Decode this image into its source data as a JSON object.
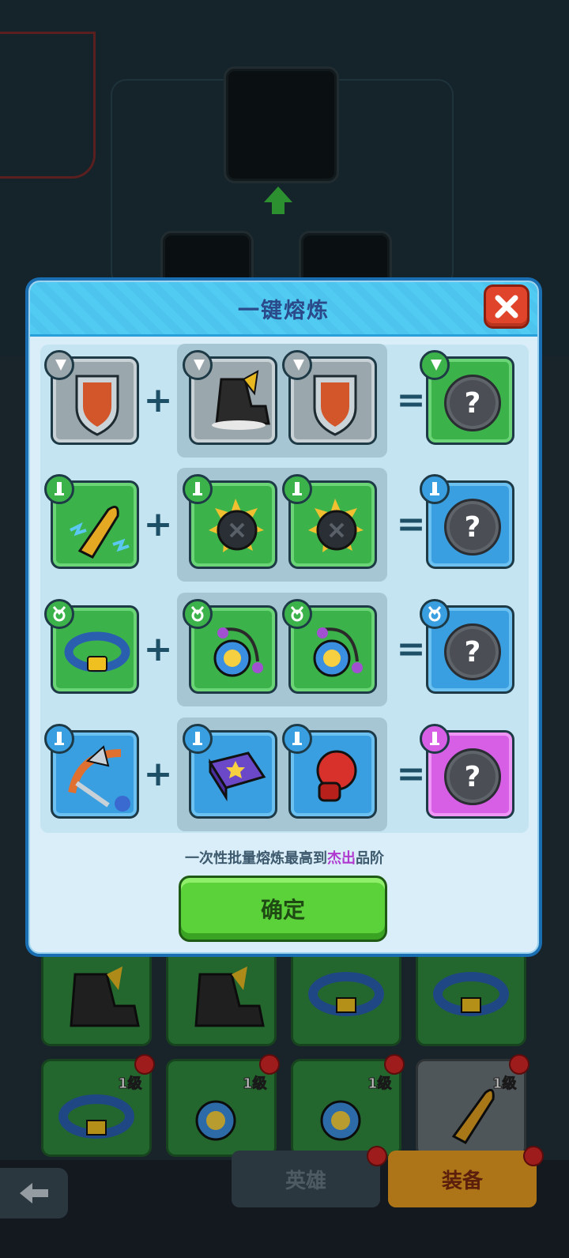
{
  "dialog": {
    "title": "一键熔炼",
    "hint_prefix": "一次性批量熔炼最高到",
    "hint_highlight": "杰出",
    "hint_suffix": "品阶",
    "confirm_label": "确定"
  },
  "recipes": [
    {
      "inputs": [
        {
          "item": "shield-icon",
          "tier": "grey",
          "slot": "armor"
        },
        {
          "item": "boot-icon",
          "tier": "grey",
          "slot": "armor"
        },
        {
          "item": "shield-icon",
          "tier": "grey",
          "slot": "armor"
        }
      ],
      "result": {
        "tier": "green",
        "label": "?"
      }
    },
    {
      "inputs": [
        {
          "item": "golden-bullet-icon",
          "tier": "green",
          "slot": "weapon"
        },
        {
          "item": "bomb-icon",
          "tier": "green",
          "slot": "weapon"
        },
        {
          "item": "bomb-icon",
          "tier": "green",
          "slot": "weapon"
        }
      ],
      "result": {
        "tier": "blue",
        "label": "?"
      }
    },
    {
      "inputs": [
        {
          "item": "ring-belt-icon",
          "tier": "green",
          "slot": "necklace"
        },
        {
          "item": "amulet-icon",
          "tier": "green",
          "slot": "necklace"
        },
        {
          "item": "amulet-icon",
          "tier": "green",
          "slot": "necklace"
        }
      ],
      "result": {
        "tier": "blue",
        "label": "?"
      }
    },
    {
      "inputs": [
        {
          "item": "crossbow-icon",
          "tier": "blue",
          "slot": "weapon"
        },
        {
          "item": "spellbook-icon",
          "tier": "blue",
          "slot": "weapon"
        },
        {
          "item": "boxing-glove-icon",
          "tier": "blue",
          "slot": "weapon"
        }
      ],
      "result": {
        "tier": "purple",
        "label": "?"
      }
    }
  ],
  "operators": {
    "plus": "+",
    "equals": "="
  },
  "inventory": {
    "level_label": "1级"
  },
  "bottom_tabs": {
    "hero": "英雄",
    "equipment": "装备"
  },
  "colors": {
    "grey": "#9aa7ad",
    "green": "#3cb34a",
    "blue": "#3a9fe0",
    "purple": "#d65fe6",
    "highlight": "#b03ad0",
    "confirm": "#5bd23a"
  }
}
